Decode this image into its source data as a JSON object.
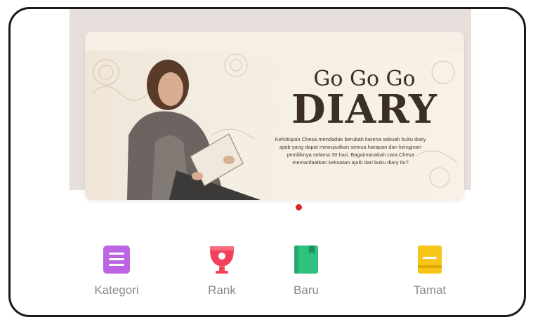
{
  "banner": {
    "title_small": "Go Go Go",
    "title_big": "DIARY",
    "synopsis": "Kehidupan Chesa mendadak berubah karena sebuah buku diary ajaib yang dapat mewujudkan semua harapan dan keinginan pemiliknya selama 30 hari. Bagaimanakah cara Chesa memanfaatkan kekuatan ajaib dari buku diary itu?"
  },
  "carousel": {
    "active_index": 0,
    "dot_color": "#e02424"
  },
  "nav": [
    {
      "label": "Kategori",
      "icon": "list-icon",
      "color": "#c46de8"
    },
    {
      "label": "Rank",
      "icon": "trophy-icon",
      "color": "#f2415a"
    },
    {
      "label": "Baru",
      "icon": "book-icon",
      "color": "#2ec27e"
    },
    {
      "label": "Tamat",
      "icon": "finished-book-icon",
      "color": "#f5c518"
    }
  ]
}
